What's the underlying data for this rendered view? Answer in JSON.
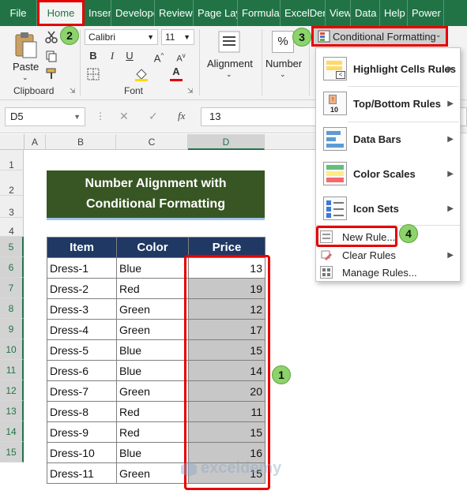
{
  "ribbon_tabs": [
    "File",
    "Home",
    "Insert",
    "Develope",
    "Review",
    "Page Lay",
    "Formulas",
    "ExcelDer",
    "View",
    "Data",
    "Help",
    "Power Pi"
  ],
  "clipboard": {
    "paste": "Paste",
    "label": "Clipboard"
  },
  "font": {
    "name": "Calibri",
    "size": "11",
    "label": "Font"
  },
  "alignment": {
    "label": "Alignment"
  },
  "number": {
    "label": "Number",
    "symbol": "%"
  },
  "cond_format_button": "Conditional Formatting",
  "formula_bar": {
    "name_box": "D5",
    "fx": "fx",
    "value": "13"
  },
  "columns": [
    "A",
    "B",
    "C",
    "D"
  ],
  "rows": [
    "1",
    "2",
    "3",
    "4",
    "5",
    "6",
    "7",
    "8",
    "9",
    "10",
    "11",
    "12",
    "13",
    "14",
    "15"
  ],
  "title_lines": [
    "Number Alignment with",
    "Conditional Formatting"
  ],
  "table": {
    "headers": [
      "Item",
      "Color",
      "Price"
    ],
    "rows": [
      [
        "Dress-1",
        "Blue",
        "13"
      ],
      [
        "Dress-2",
        "Red",
        "19"
      ],
      [
        "Dress-3",
        "Green",
        "12"
      ],
      [
        "Dress-4",
        "Green",
        "17"
      ],
      [
        "Dress-5",
        "Blue",
        "15"
      ],
      [
        "Dress-6",
        "Blue",
        "14"
      ],
      [
        "Dress-7",
        "Green",
        "20"
      ],
      [
        "Dress-8",
        "Red",
        "11"
      ],
      [
        "Dress-9",
        "Red",
        "15"
      ],
      [
        "Dress-10",
        "Blue",
        "16"
      ],
      [
        "Dress-11",
        "Green",
        "15"
      ]
    ]
  },
  "menu": {
    "highlight": "Highlight Cells Rules",
    "topbottom": "Top/Bottom Rules",
    "databars": "Data Bars",
    "colorscales": "Color Scales",
    "iconsets": "Icon Sets",
    "newrule": "New Rule...",
    "clearrules": "Clear Rules",
    "managerules": "Manage Rules..."
  },
  "badges": [
    "1",
    "2",
    "3",
    "4"
  ],
  "watermark": "exceldemy",
  "colors": {
    "excel_green": "#217346",
    "title_fill": "#375623",
    "header_fill": "#1f3864",
    "highlight_red": "#e60000",
    "badge_green": "#8bd36a"
  }
}
